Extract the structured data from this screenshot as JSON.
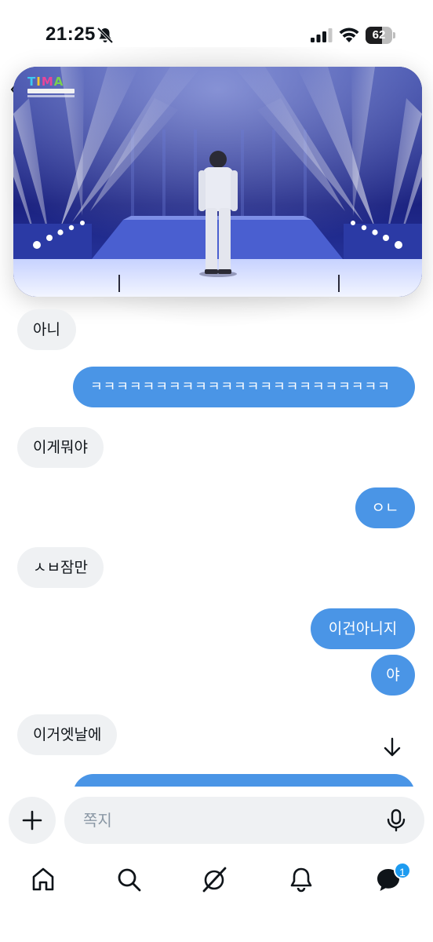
{
  "status_bar": {
    "time": "21:25",
    "icons": [
      "bell-off-icon",
      "cellular-signal-icon",
      "wifi-icon",
      "battery-icon"
    ],
    "battery_level": "62",
    "battery_fraction": 0.62
  },
  "video": {
    "logo_text": "TIMA",
    "description_icon": "concert-stage-video-thumbnail"
  },
  "messages": [
    {
      "direction": "in",
      "text": "아니"
    },
    {
      "direction": "out",
      "text": "ㅋㅋㅋㅋㅋㅋㅋㅋㅋㅋㅋㅋㅋㅋㅋㅋㅋㅋㅋㅋㅋㅋㅋ"
    },
    {
      "direction": "in",
      "text": "이게뭐야"
    },
    {
      "direction": "out",
      "text": "ㅇㄴ"
    },
    {
      "direction": "in",
      "text": "ㅅㅂ잠만"
    },
    {
      "direction": "out",
      "text": "이건아니지"
    },
    {
      "direction": "out",
      "text": "야"
    },
    {
      "direction": "in",
      "text": "이거엣날에"
    }
  ],
  "composer": {
    "placeholder": "쪽지",
    "value": "",
    "add_icon": "plus-icon",
    "voice_icon": "microphone-icon"
  },
  "bottom_nav": {
    "items": [
      "home-icon",
      "search-icon",
      "grok-icon",
      "notifications-icon",
      "messages-icon"
    ],
    "messages_badge": "1"
  },
  "colors": {
    "outgoing_bubble": "#4a95e6",
    "incoming_bubble": "#eff1f3",
    "badge": "#1d9bf0"
  }
}
